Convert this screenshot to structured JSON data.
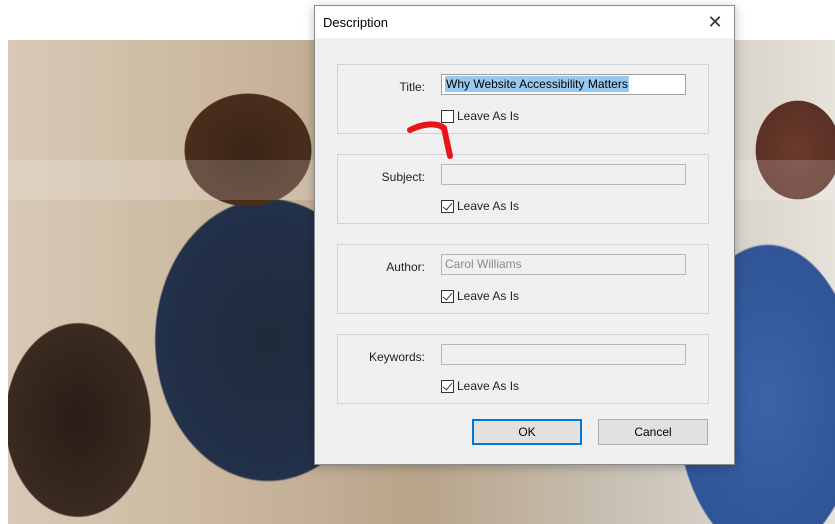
{
  "dialog": {
    "title": "Description",
    "close_glyph": "✕",
    "fields": [
      {
        "label": "Title:",
        "value": "Why Website Accessibility Matters",
        "selected": true,
        "disabled": false,
        "leave_as_is": false
      },
      {
        "label": "Subject:",
        "value": "",
        "selected": false,
        "disabled": true,
        "leave_as_is": true
      },
      {
        "label": "Author:",
        "value": "Carol Williams",
        "selected": false,
        "disabled": true,
        "leave_as_is": true
      },
      {
        "label": "Keywords:",
        "value": "",
        "selected": false,
        "disabled": true,
        "leave_as_is": true
      }
    ],
    "checkbox_label": "Leave As Is",
    "ok_label": "OK",
    "cancel_label": "Cancel"
  },
  "annotation": {
    "icon": "red-arrow-icon",
    "color": "#e8141c"
  },
  "colors": {
    "selection": "#99c9ef",
    "ok_border": "#0078d7"
  }
}
